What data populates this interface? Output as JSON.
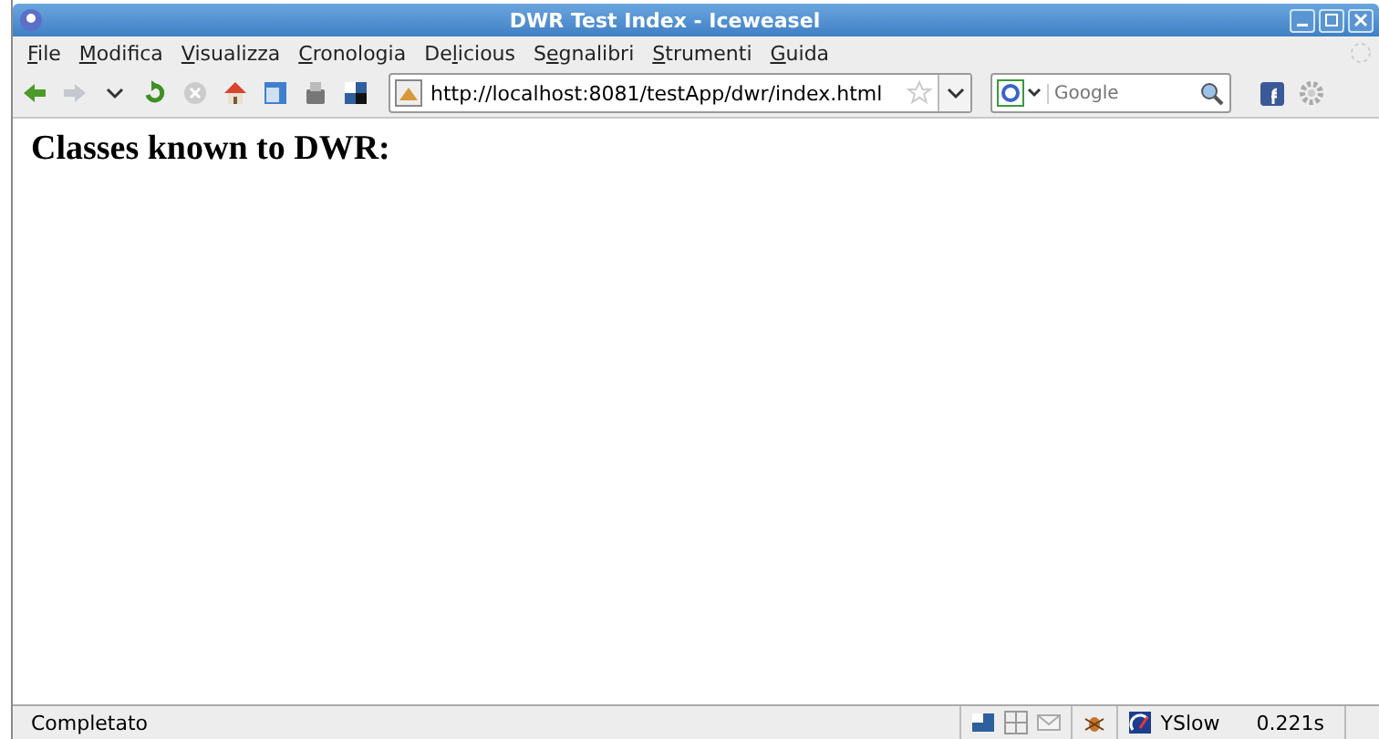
{
  "window": {
    "title": "DWR Test Index - Iceweasel"
  },
  "menu": [
    {
      "key": "F",
      "after": "ile"
    },
    {
      "key": "M",
      "after": "odifica"
    },
    {
      "key": "V",
      "after": "isualizza"
    },
    {
      "key": "C",
      "after": "ronologia"
    },
    {
      "before": "De",
      "key": "l",
      "after": "icious"
    },
    {
      "before": "S",
      "key": "e",
      "after": "gnalibri"
    },
    {
      "key": "S",
      "after": "trumenti"
    },
    {
      "key": "G",
      "after": "uida"
    }
  ],
  "address": {
    "value": "http://localhost:8081/testApp/dwr/index.html"
  },
  "search": {
    "placeholder": "Google"
  },
  "page": {
    "heading": "Classes known to DWR:"
  },
  "status_bar": {
    "text": "Completato",
    "yslow": "YSlow",
    "time": "0.221s"
  }
}
